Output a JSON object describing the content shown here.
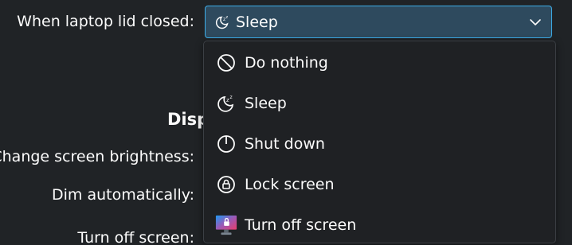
{
  "settings": {
    "lid_label": "When laptop lid closed:",
    "section_title": "Disp",
    "brightness_label": "Change screen brightness:",
    "dim_label": "Dim automatically:",
    "turn_off_label": "Turn off screen:"
  },
  "lid_combo": {
    "selected": "Sleep",
    "selected_icon": "sleep-moon-icon"
  },
  "dropdown": {
    "items": [
      {
        "label": "Do nothing",
        "icon": "prohibited-icon"
      },
      {
        "label": "Sleep",
        "icon": "sleep-moon-icon"
      },
      {
        "label": "Shut down",
        "icon": "power-icon"
      },
      {
        "label": "Lock screen",
        "icon": "lock-icon"
      },
      {
        "label": "Turn off screen",
        "icon": "monitor-lock-icon"
      }
    ]
  },
  "colors": {
    "background": "#202326",
    "accent": "#3daee9",
    "combo_fill": "#2e4a5e",
    "menu_background": "#1f2124",
    "text": "#fcfcfc"
  }
}
